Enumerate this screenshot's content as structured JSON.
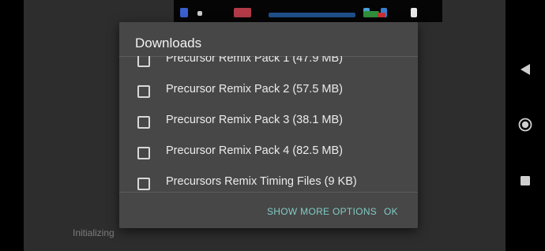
{
  "background": {
    "status": "Initializing"
  },
  "dialog": {
    "title": "Downloads",
    "items": [
      {
        "label": "Precursor Remix Pack 1 (47.9 MB)",
        "checked": false
      },
      {
        "label": "Precursor Remix Pack 2 (57.5 MB)",
        "checked": false
      },
      {
        "label": "Precursor Remix Pack 3 (38.1 MB)",
        "checked": false
      },
      {
        "label": "Precursor Remix Pack 4 (82.5 MB)",
        "checked": false
      },
      {
        "label": "Precursors Remix Timing Files (9 KB)",
        "checked": false
      }
    ],
    "more_options_label": "SHOW MORE OPTIONS",
    "ok_label": "OK"
  },
  "nav": {
    "icons": [
      "back-icon",
      "home-icon",
      "recents-icon"
    ]
  },
  "colors": {
    "accent": "#80cbc4",
    "dialog_bg": "#474747",
    "app_bg": "#2d2d2d"
  }
}
